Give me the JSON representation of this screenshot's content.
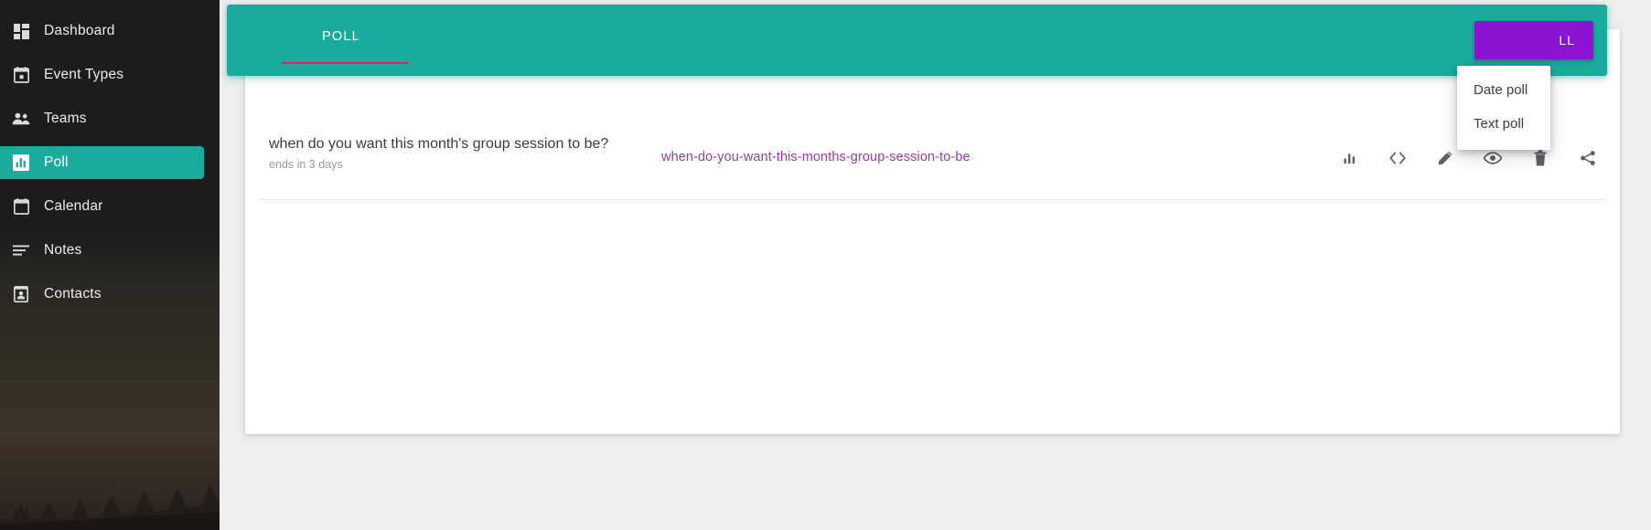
{
  "sidebar": {
    "items": [
      {
        "label": "Dashboard",
        "icon": "dashboard-grid-icon",
        "active": false
      },
      {
        "label": "Event Types",
        "icon": "event-calendar-icon",
        "active": false
      },
      {
        "label": "Teams",
        "icon": "people-icon",
        "active": false
      },
      {
        "label": "Poll",
        "icon": "bar-chart-icon",
        "active": true
      },
      {
        "label": "Calendar",
        "icon": "calendar-icon",
        "active": false
      },
      {
        "label": "Notes",
        "icon": "notes-lines-icon",
        "active": false
      },
      {
        "label": "Contacts",
        "icon": "contact-card-icon",
        "active": false
      }
    ],
    "active_bg": "#1bab9c",
    "bg": "#232323"
  },
  "header": {
    "tab_label": "POLL",
    "tab_indicator_color": "#e81c5b",
    "bg": "#1bab9c",
    "create_button_label": "LL",
    "create_button_color": "#8a14d1"
  },
  "dropdown": {
    "items": [
      {
        "label": "Date poll"
      },
      {
        "label": "Text poll"
      }
    ]
  },
  "poll": {
    "title": "when do you want this month's group session to be?",
    "subtitle": "ends in 3 days",
    "slug": "when-do-you-want-this-months-group-session-to-be",
    "slug_color": "#9b3aa8",
    "actions": [
      {
        "name": "stats-bar-chart-icon",
        "title": "Results"
      },
      {
        "name": "embed-code-icon",
        "title": "Embed"
      },
      {
        "name": "edit-pencil-icon",
        "title": "Edit"
      },
      {
        "name": "preview-eye-icon",
        "title": "Preview"
      },
      {
        "name": "delete-trash-icon",
        "title": "Delete"
      },
      {
        "name": "share-icon",
        "title": "Share"
      }
    ]
  }
}
